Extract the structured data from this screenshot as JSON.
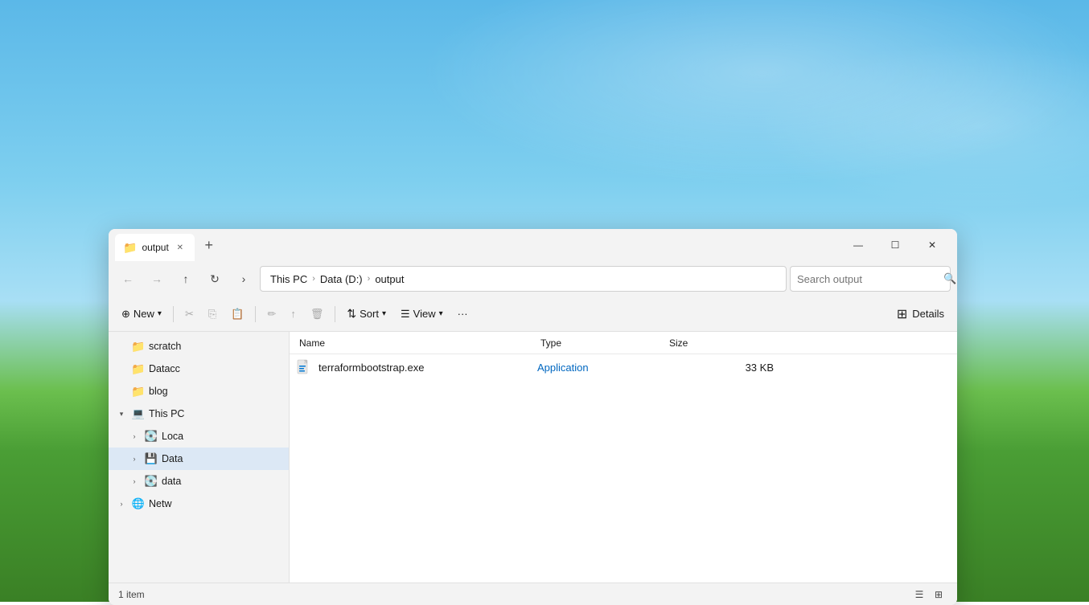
{
  "desktop": {
    "bg_description": "Windows XP bliss style background"
  },
  "window": {
    "title": "output",
    "tab_label": "output",
    "tab_icon": "📁"
  },
  "nav": {
    "back_disabled": true,
    "forward_disabled": true,
    "up_label": "↑",
    "refresh_label": "⟳",
    "breadcrumbs": [
      {
        "label": "This PC",
        "sep": true
      },
      {
        "label": "Data (D:)",
        "sep": true
      },
      {
        "label": "output",
        "sep": false
      }
    ],
    "search_placeholder": "Search output"
  },
  "toolbar": {
    "new_label": "New",
    "cut_label": "✂",
    "copy_label": "⎘",
    "paste_label": "📋",
    "rename_label": "✏",
    "share_label": "↑",
    "delete_label": "🗑",
    "sort_label": "Sort",
    "view_label": "View",
    "more_label": "···",
    "details_label": "Details"
  },
  "sidebar": {
    "items": [
      {
        "id": "scratch",
        "label": "scratch",
        "type": "folder",
        "indent": 0,
        "chevron": false,
        "active": false
      },
      {
        "id": "dataccc",
        "label": "Datacc",
        "type": "folder",
        "indent": 0,
        "chevron": false,
        "active": false
      },
      {
        "id": "blog",
        "label": "blog",
        "type": "folder",
        "indent": 0,
        "chevron": false,
        "active": false
      },
      {
        "id": "this-pc",
        "label": "This PC",
        "type": "pc",
        "indent": 0,
        "chevron": true,
        "expanded": true,
        "active": false
      },
      {
        "id": "local",
        "label": "Loca",
        "type": "drive",
        "indent": 1,
        "chevron": true,
        "active": false
      },
      {
        "id": "data-d",
        "label": "Data",
        "type": "drive",
        "indent": 1,
        "chevron": true,
        "active": true
      },
      {
        "id": "data2",
        "label": "data",
        "type": "drive",
        "indent": 1,
        "chevron": true,
        "active": false
      },
      {
        "id": "network",
        "label": "Netw",
        "type": "network",
        "indent": 0,
        "chevron": true,
        "active": false
      }
    ]
  },
  "file_list": {
    "columns": [
      {
        "id": "name",
        "label": "Name"
      },
      {
        "id": "type",
        "label": "Type"
      },
      {
        "id": "size",
        "label": "Size"
      }
    ],
    "files": [
      {
        "name": "terraformbootstrap.exe",
        "type": "Application",
        "size": "33 KB",
        "icon": "exe"
      }
    ]
  },
  "status_bar": {
    "count_text": "1 item"
  }
}
